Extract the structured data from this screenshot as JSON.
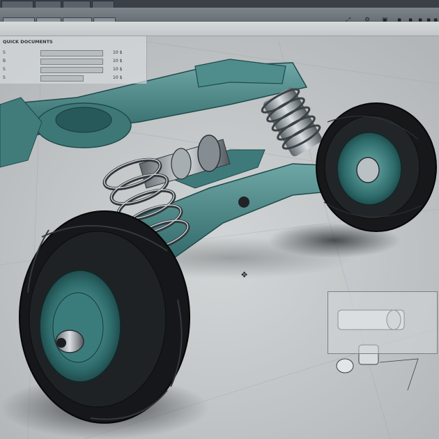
{
  "app": {
    "toolbar_icons": [
      "expand-icon",
      "tools-icon",
      "box-icon",
      "marker-icon",
      "marker-icon",
      "marker-icon",
      "marker-icon",
      "marker-icon"
    ]
  },
  "panel": {
    "title": "QUICK DOCUMENTS",
    "rows": [
      {
        "label": "S",
        "value": "10",
        "unit": "$"
      },
      {
        "label": "B",
        "value": "10",
        "unit": "$"
      },
      {
        "label": "S",
        "value": "10",
        "unit": "$"
      },
      {
        "label": "S",
        "value": "10",
        "unit": "$"
      }
    ]
  },
  "viewport": {
    "model": "wheel-suspension-assembly",
    "accent_color": "#3f8c8c",
    "tire_color": "#16181a",
    "spring_color": "#9aa3a8",
    "floor_color": "#c9cccd"
  }
}
